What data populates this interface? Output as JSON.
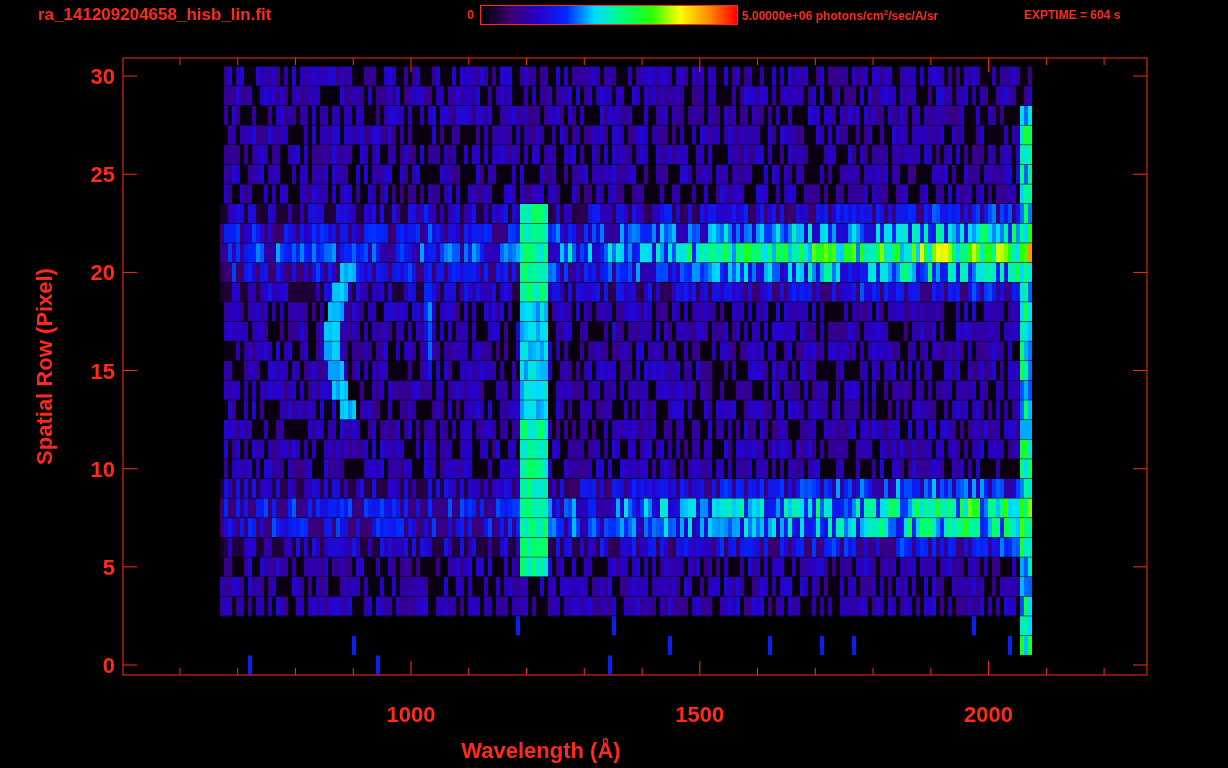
{
  "title": "ra_141209204658_hisb_lin.fit",
  "colorbar": {
    "min_label": "0",
    "max_label": "5.00000e+06 photons/cm$^{2}$/sec/A/sr"
  },
  "exptime": "EXPTIME = 604 s",
  "plot": {
    "xlabel": "Wavelength (Å)",
    "ylabel": "Spatial Row (Pixel)",
    "xticks": [
      "1000",
      "1500",
      "2000"
    ],
    "yticks": [
      "30",
      "25",
      "20",
      "15",
      "10",
      "5",
      "0"
    ]
  }
}
